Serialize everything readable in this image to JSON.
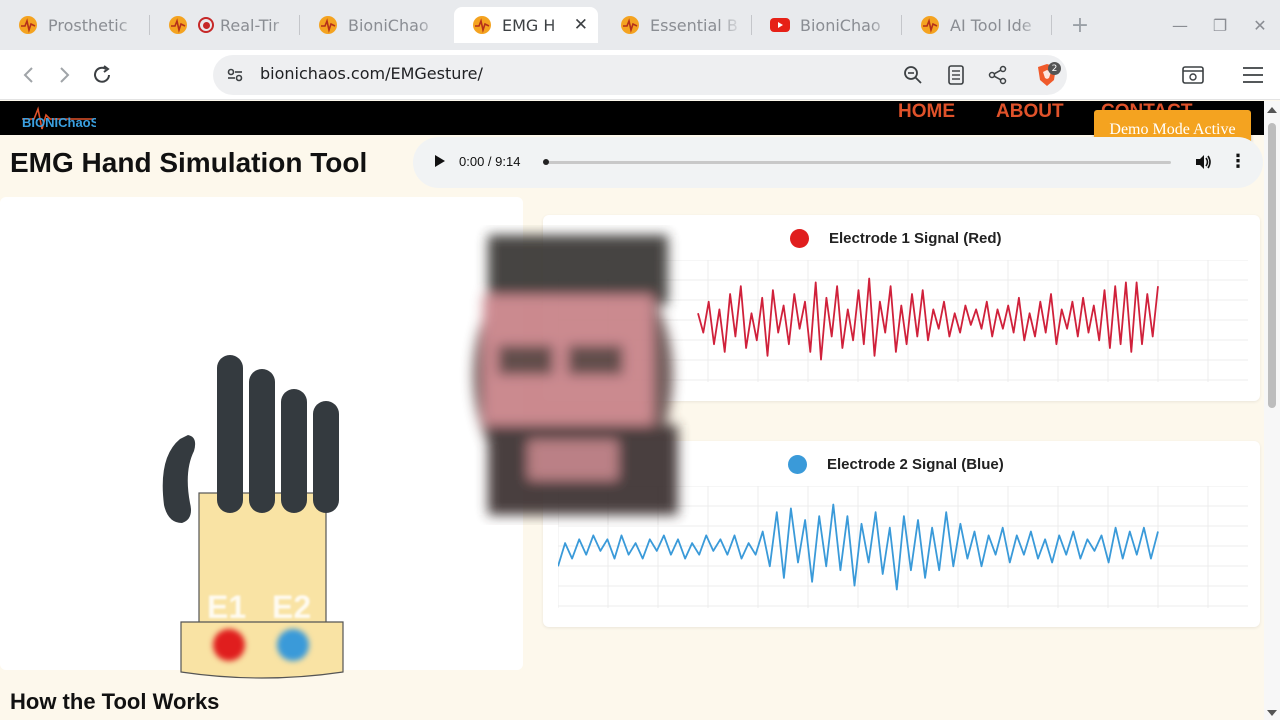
{
  "browser": {
    "tabs": [
      {
        "title": "Prosthetic",
        "favicon": "bionichaos-icon",
        "active": false
      },
      {
        "title": "Real-Tir",
        "favicon": "bionichaos-icon",
        "recording": true,
        "active": false
      },
      {
        "title": "BioniChao",
        "favicon": "bionichaos-icon",
        "active": false
      },
      {
        "title": "EMG H",
        "favicon": "bionichaos-icon",
        "active": true
      },
      {
        "title": "Essential B",
        "favicon": "bionichaos-icon",
        "active": false
      },
      {
        "title": "BioniChao",
        "favicon": "youtube-icon",
        "active": false
      },
      {
        "title": "AI Tool Ide",
        "favicon": "bionichaos-icon",
        "active": false
      }
    ],
    "url": "bionichaos.com/EMGesture/",
    "shield_badge": "2"
  },
  "site": {
    "logo_text": "BIONIChaoS",
    "nav": {
      "home": "HOME",
      "about": "ABOUT",
      "contact": "CONTACT"
    },
    "demo_badge": "Demo Mode Active"
  },
  "main": {
    "title": "EMG Hand Simulation Tool",
    "audio": {
      "time": "0:00 / 9:14",
      "progress": 0
    },
    "electrode_labels": {
      "e1": "E1",
      "e2": "E2"
    },
    "section_title": "How the Tool Works"
  },
  "colors": {
    "electrode1": "#e01e1e",
    "electrode2": "#3a9ad9",
    "accent": "#e0522a",
    "badge": "#f4a320"
  },
  "chart_data": [
    {
      "type": "line",
      "title": "Electrode 1 Signal (Red)",
      "color": "#d0213b",
      "series": [
        {
          "values": [
            0.2,
            -0.3,
            0.5,
            -0.6,
            0.3,
            -0.8,
            0.7,
            -0.4,
            0.9,
            -0.7,
            0.2,
            -0.5,
            0.6,
            -0.9,
            0.8,
            -0.3,
            0.4,
            -0.6,
            0.7,
            -0.2,
            0.5,
            -0.8,
            1.0,
            -1.0,
            0.6,
            -0.4,
            0.9,
            -0.7,
            0.3,
            -0.5,
            0.8,
            -0.6,
            1.1,
            -0.9,
            0.5,
            -0.3,
            0.9,
            -0.8,
            0.4,
            -0.6,
            0.7,
            -0.4,
            0.8,
            -0.5,
            0.3,
            -0.2,
            0.5,
            -0.4,
            0.2,
            -0.3,
            0.4,
            -0.1,
            0.3,
            -0.2,
            0.5,
            -0.4,
            0.3,
            -0.2,
            0.4,
            -0.3,
            0.6,
            -0.5,
            0.2,
            -0.4,
            0.5,
            -0.3,
            0.7,
            -0.6,
            0.3,
            -0.2,
            0.5,
            -0.4,
            0.6,
            -0.3,
            0.4,
            -0.5,
            0.8,
            -0.7,
            0.9,
            -0.6,
            1.0,
            -0.8,
            1.0,
            -0.6,
            0.7,
            -0.4,
            0.9
          ]
        }
      ],
      "ylim": [
        -1.5,
        1.5
      ],
      "grid": true
    },
    {
      "type": "line",
      "title": "Electrode 2 Signal (Blue)",
      "color": "#3a9ad9",
      "series": [
        {
          "values": [
            -0.5,
            0.1,
            -0.3,
            0.2,
            -0.2,
            0.3,
            -0.1,
            0.2,
            -0.3,
            0.3,
            -0.2,
            0.1,
            -0.3,
            0.2,
            -0.1,
            0.3,
            -0.2,
            0.2,
            -0.3,
            0.1,
            -0.2,
            0.3,
            -0.1,
            0.2,
            -0.2,
            0.3,
            -0.3,
            0.1,
            -0.2,
            0.4,
            -0.5,
            0.9,
            -0.8,
            1.0,
            -0.4,
            0.7,
            -0.9,
            0.8,
            -0.5,
            1.1,
            -0.6,
            0.8,
            -1.0,
            0.6,
            -0.4,
            0.9,
            -0.7,
            0.5,
            -1.1,
            0.8,
            -0.6,
            0.7,
            -0.8,
            0.5,
            -0.6,
            0.9,
            -0.5,
            0.6,
            -0.3,
            0.4,
            -0.5,
            0.3,
            -0.2,
            0.5,
            -0.4,
            0.3,
            -0.2,
            0.4,
            -0.3,
            0.2,
            -0.4,
            0.3,
            -0.2,
            0.4,
            -0.3,
            0.2,
            -0.1,
            0.3,
            -0.4,
            0.5,
            -0.3,
            0.4,
            -0.2,
            0.5,
            -0.3,
            0.4
          ]
        }
      ],
      "ylim": [
        -1.5,
        1.5
      ],
      "grid": true
    }
  ]
}
